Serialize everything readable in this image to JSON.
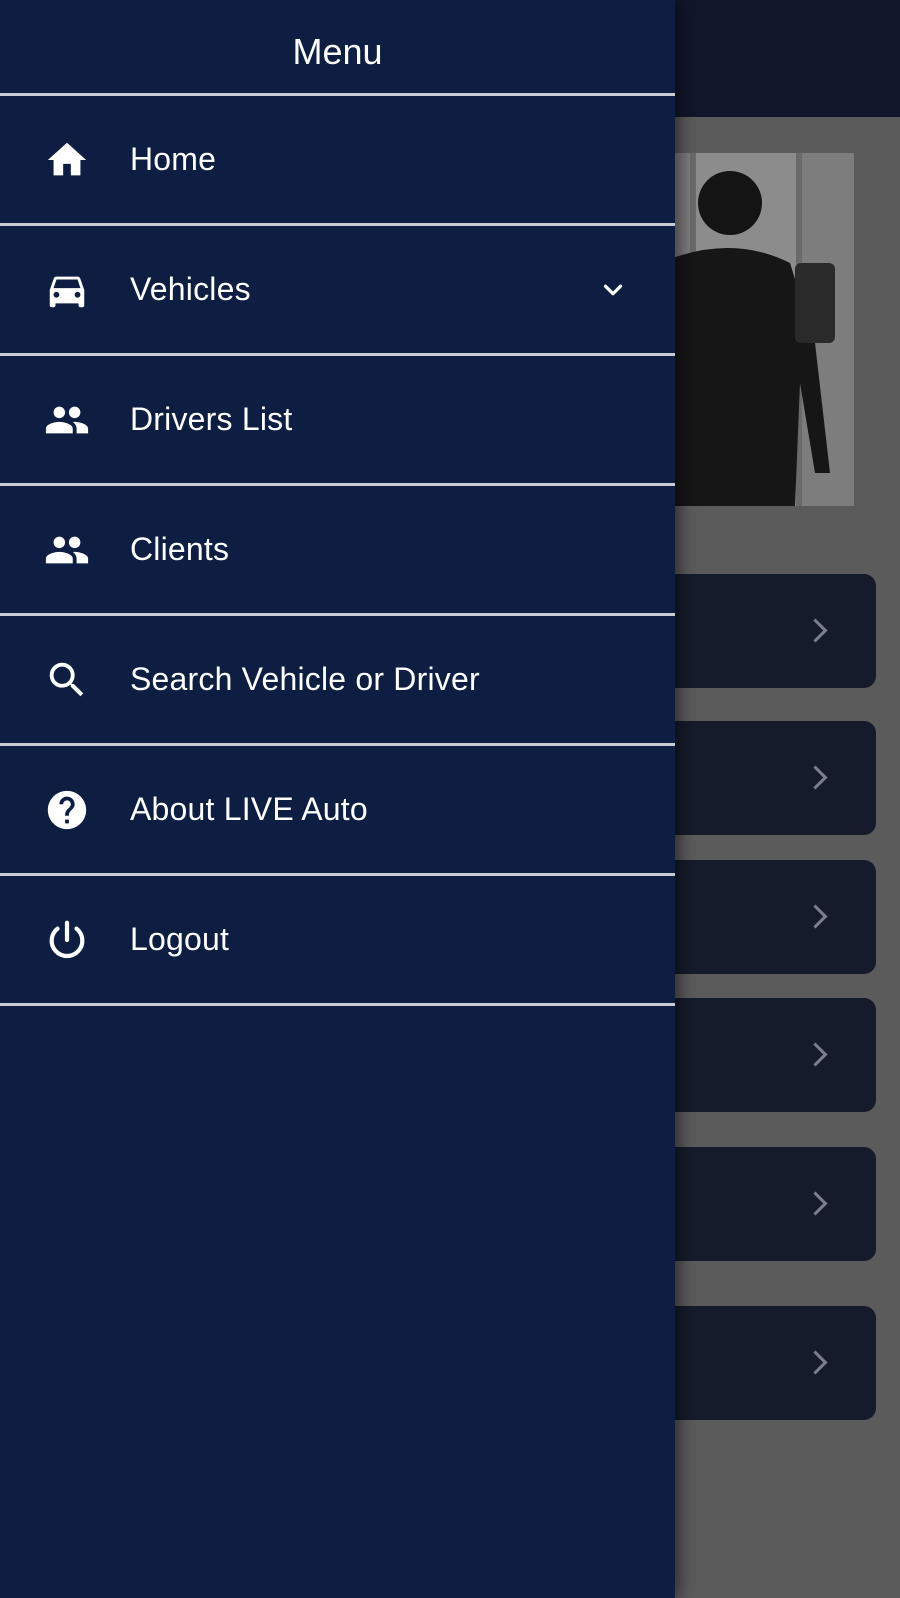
{
  "drawer": {
    "title": "Menu",
    "items": [
      {
        "label": "Home",
        "icon": "home-icon"
      },
      {
        "label": "Vehicles",
        "icon": "car-icon",
        "expandable": true
      },
      {
        "label": "Drivers List",
        "icon": "people-icon"
      },
      {
        "label": "Clients",
        "icon": "people-icon"
      },
      {
        "label": "Search Vehicle or Driver",
        "icon": "search-icon"
      },
      {
        "label": "About LIVE Auto",
        "icon": "help-circle-icon"
      },
      {
        "label": "Logout",
        "icon": "power-icon"
      }
    ]
  },
  "colors": {
    "drawer_background": "#0e1e42",
    "divider": "#c9ccd3",
    "text": "#ffffff",
    "overlay_background": "#5b5b5b",
    "background_card": "#161b2c"
  }
}
